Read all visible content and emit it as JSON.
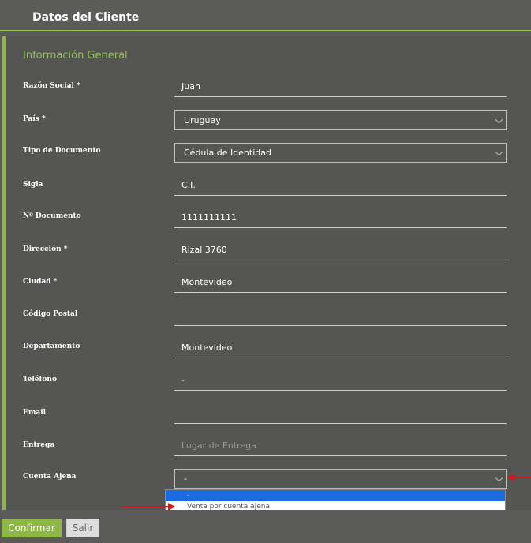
{
  "header": {
    "title": "Datos del Cliente"
  },
  "section": {
    "title": "Información General"
  },
  "fields": [
    {
      "label": "Razón Social *",
      "value": "Juan"
    },
    {
      "label": "País *",
      "value": "Uruguay"
    },
    {
      "label": "Tipo de Documento",
      "value": "Cédula de Identidad"
    },
    {
      "label": "Sigla",
      "value": "C.I."
    },
    {
      "label": "Nº Documento",
      "value": "1111111111"
    },
    {
      "label": "Dirección *",
      "value": "Rizal 3760"
    },
    {
      "label": "Ciudad *",
      "value": "Montevideo"
    },
    {
      "label": "Código Postal",
      "value": ""
    },
    {
      "label": "Departamento",
      "value": "Montevideo"
    },
    {
      "label": "Teléfono",
      "value": "-"
    },
    {
      "label": "Email",
      "value": ""
    },
    {
      "label": "Entrega",
      "value": "",
      "placeholder": "Lugar de Entrega"
    },
    {
      "label": "Cuenta Ajena",
      "value": "-"
    }
  ],
  "dropdown": {
    "options": [
      "-",
      "Venta por cuenta ajena"
    ],
    "selected": "-"
  },
  "buttons": {
    "confirm": "Confirmar",
    "exit": "Salir"
  },
  "colors": {
    "accent": "#8db846",
    "highlight": "#1a6be0",
    "annotation": "#d9141a"
  },
  "icons": {
    "select_arrow": "chevron-down-icon"
  }
}
